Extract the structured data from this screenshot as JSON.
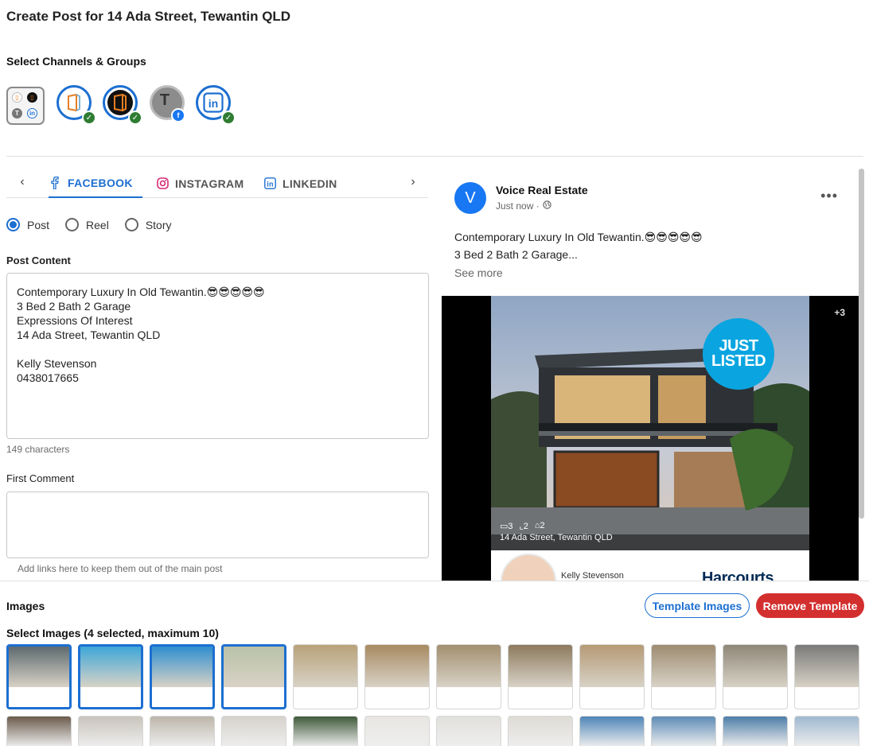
{
  "page_title": "Create Post for 14 Ada Street, Tewantin QLD",
  "channels_label": "Select Channels & Groups",
  "channels": [
    {
      "name": "all-groups",
      "icon": "group-grid-icon"
    },
    {
      "name": "voice-brand-light",
      "icon": "brand-logo-icon",
      "status": "check-icon"
    },
    {
      "name": "voice-brand-dark",
      "icon": "brand-logo-icon",
      "status": "check-icon"
    },
    {
      "name": "t-facebook",
      "icon": "T",
      "status": "facebook-icon"
    },
    {
      "name": "linkedin",
      "icon": "in",
      "status": "check-icon"
    }
  ],
  "tabs": [
    {
      "label": "FACEBOOK",
      "icon": "facebook-icon",
      "active": true
    },
    {
      "label": "INSTAGRAM",
      "icon": "instagram-icon",
      "active": false
    },
    {
      "label": "LINKEDIN",
      "icon": "linkedin-icon",
      "active": false
    }
  ],
  "post_types": [
    {
      "label": "Post",
      "checked": true
    },
    {
      "label": "Reel",
      "checked": false
    },
    {
      "label": "Story",
      "checked": false
    }
  ],
  "post_content": {
    "label": "Post Content",
    "value": "Contemporary Luxury In Old Tewantin.😎😎😎😎😎\n3 Bed 2 Bath 2 Garage\nExpressions Of Interest\n14 Ada Street, Tewantin QLD\n\nKelly Stevenson\n0438017665",
    "char_count": "149 characters"
  },
  "first_comment": {
    "label": "First Comment",
    "value": "",
    "helper": "Add links here to keep them out of the main post"
  },
  "preview": {
    "avatar_letter": "V",
    "page_name": "Voice Real Estate",
    "time": "Just now ·",
    "line1": "Contemporary Luxury In Old Tewantin.😎😎😎😎😎",
    "line2": "3 Bed 2 Bath 2 Garage...",
    "see_more": "See more",
    "more_count": "+3",
    "badge_line1": "JUST",
    "badge_line2": "LISTED",
    "beds": "3",
    "baths": "2",
    "cars": "2",
    "address": "14 Ada Street, Tewantin QLD",
    "agent_name": "Kelly Stevenson",
    "brand": "Harcourts"
  },
  "images": {
    "label": "Images",
    "select_label": "Select Images (4 selected, maximum 10)",
    "template_button": "Template Images",
    "remove_button": "Remove Template",
    "row1": [
      {
        "selected": true,
        "color": "#5e6a6f"
      },
      {
        "selected": true,
        "color": "#3ea7d8"
      },
      {
        "selected": true,
        "color": "#2f8fd0"
      },
      {
        "selected": true,
        "color": "#b9c2a8"
      },
      {
        "selected": false,
        "color": "#b8a27a"
      },
      {
        "selected": false,
        "color": "#a88a62"
      },
      {
        "selected": false,
        "color": "#a38f70"
      },
      {
        "selected": false,
        "color": "#8d7a5e"
      },
      {
        "selected": false,
        "color": "#b59a76"
      },
      {
        "selected": false,
        "color": "#9e8c72"
      },
      {
        "selected": false,
        "color": "#8f8778"
      },
      {
        "selected": false,
        "color": "#7a7a7a"
      }
    ],
    "row2_colors": [
      "#6b5b4c",
      "#c9c4bc",
      "#bdb6aa",
      "#d6d2cc",
      "#3f5a3a",
      "#e8e6e2",
      "#e2e0dc",
      "#dedbd6",
      "#4f86b8",
      "#5e8cb6",
      "#4d7ea8",
      "#9fb9d0"
    ]
  }
}
